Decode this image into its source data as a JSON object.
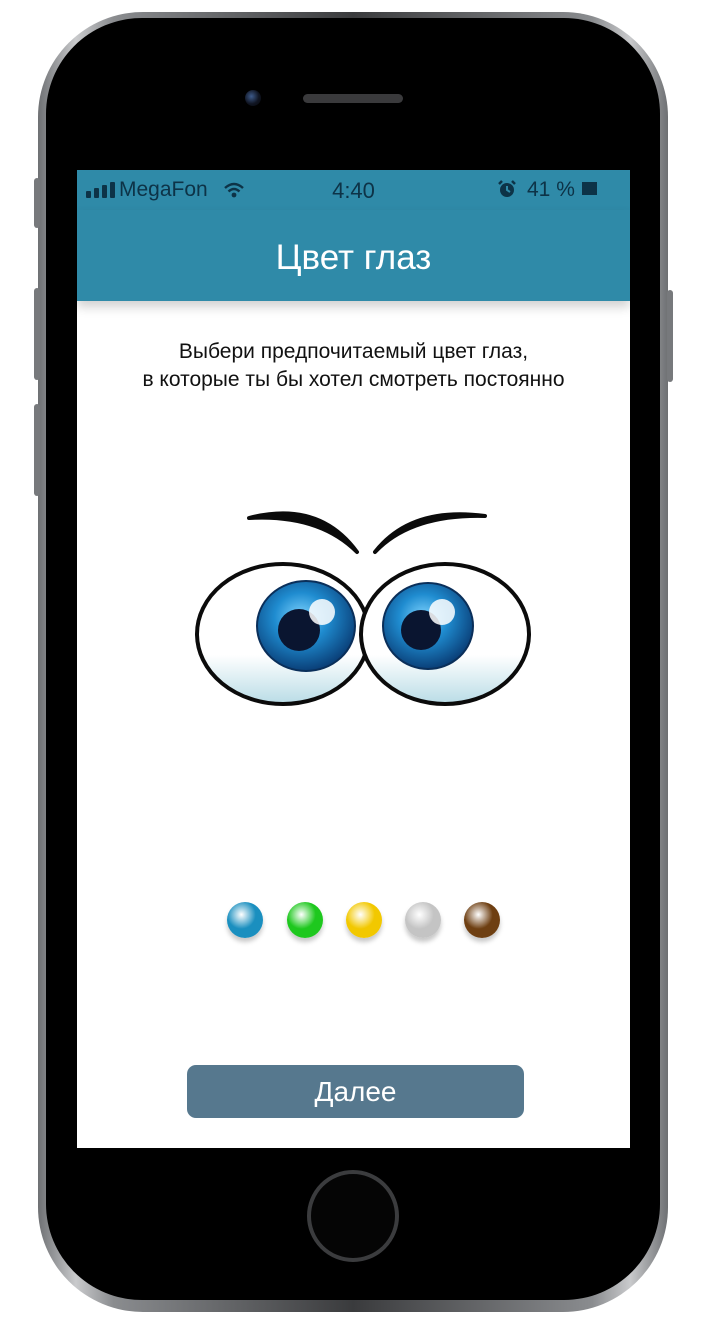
{
  "status_bar": {
    "carrier": "MegaFon",
    "time": "4:40",
    "battery": "41 %",
    "icons": [
      "signal-icon",
      "wifi-icon",
      "alarm-icon",
      "battery-icon"
    ]
  },
  "header": {
    "title": "Цвет глаз"
  },
  "instruction": {
    "line1": "Выбери предпочитаемый цвет глаз,",
    "line2": "в которые ты бы хотел смотреть постоянно"
  },
  "eye_colors": [
    {
      "name": "blue",
      "color": "#1a8fbf"
    },
    {
      "name": "green",
      "color": "#1ec81e"
    },
    {
      "name": "yellow",
      "color": "#f2c800"
    },
    {
      "name": "gray",
      "color": "#c4c4c4"
    },
    {
      "name": "brown",
      "color": "#6e3f12"
    }
  ],
  "selected_eye_color": "blue",
  "next_button": {
    "label": "Далее"
  },
  "colors": {
    "header_bg": "#2f8aa8",
    "button_bg": "#56788e"
  }
}
